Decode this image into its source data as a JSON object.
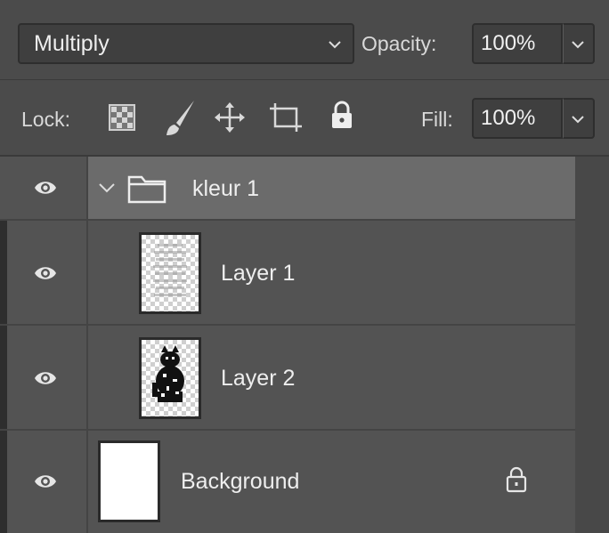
{
  "blend": {
    "mode": "Multiply",
    "opacity_label": "Opacity:",
    "opacity_value": "100%"
  },
  "lock": {
    "label": "Lock:",
    "icons": [
      "lock-transparent-pixels-icon",
      "lock-image-pixels-icon",
      "lock-position-icon",
      "lock-artboard-icon",
      "lock-all-icon"
    ],
    "fill_label": "Fill:",
    "fill_value": "100%"
  },
  "layers": [
    {
      "name": "kleur 1",
      "type": "group",
      "visible": true,
      "expanded": true,
      "selected": true
    },
    {
      "name": "Layer 1",
      "type": "pixel",
      "visible": true
    },
    {
      "name": "Layer 2",
      "type": "pixel",
      "visible": true
    },
    {
      "name": "Background",
      "type": "background",
      "visible": true,
      "locked": true
    }
  ]
}
